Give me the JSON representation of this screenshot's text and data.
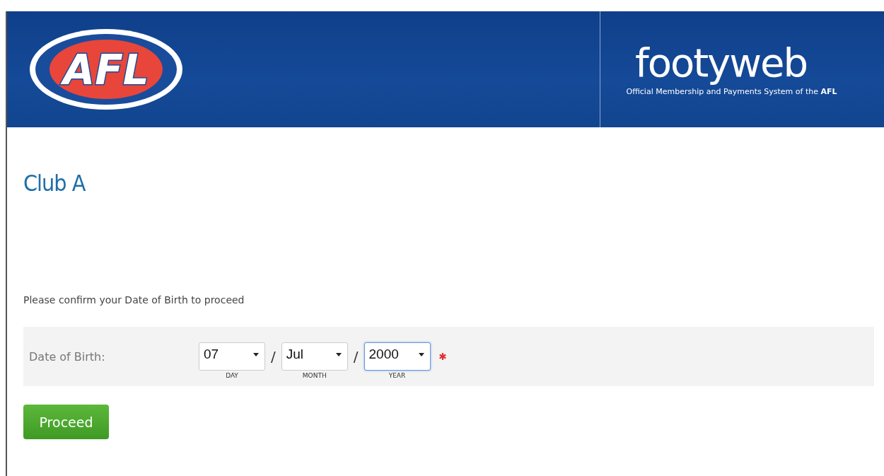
{
  "header": {
    "logo_text": "AFL",
    "brand": "footyweb",
    "tagline": "Official Membership and Payments System of the **AFL**"
  },
  "title": "Club A",
  "instruction": "Please confirm your Date of Birth to proceed",
  "form": {
    "label": "Date of Birth:",
    "required": true,
    "selects": [
      {
        "value": "07",
        "caption": "DAY",
        "focused": false
      },
      {
        "value": "Jul",
        "caption": "MONTH",
        "focused": false
      },
      {
        "value": "2000",
        "caption": "YEAR",
        "focused": true
      }
    ],
    "separators": [
      "/",
      "/"
    ]
  },
  "button": "Proceed"
}
